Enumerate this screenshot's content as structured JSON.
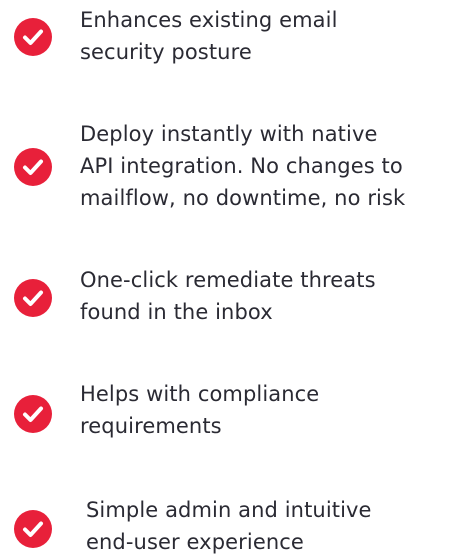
{
  "accent_color": "#e8203a",
  "features": [
    {
      "icon": "checkmark-circle-icon",
      "lines": [
        "Enhances existing email",
        "security posture"
      ]
    },
    {
      "icon": "checkmark-circle-icon",
      "lines": [
        "Deploy instantly with native",
        "API integration. No changes to",
        "mailflow, no downtime, no risk"
      ]
    },
    {
      "icon": "checkmark-circle-icon",
      "lines": [
        "One-click remediate threats",
        "found in the inbox"
      ]
    },
    {
      "icon": "checkmark-circle-icon",
      "lines": [
        "Helps with compliance",
        "requirements"
      ]
    },
    {
      "icon": "checkmark-circle-icon",
      "lines": [
        "Simple admin and intuitive",
        "end-user experience"
      ]
    }
  ]
}
